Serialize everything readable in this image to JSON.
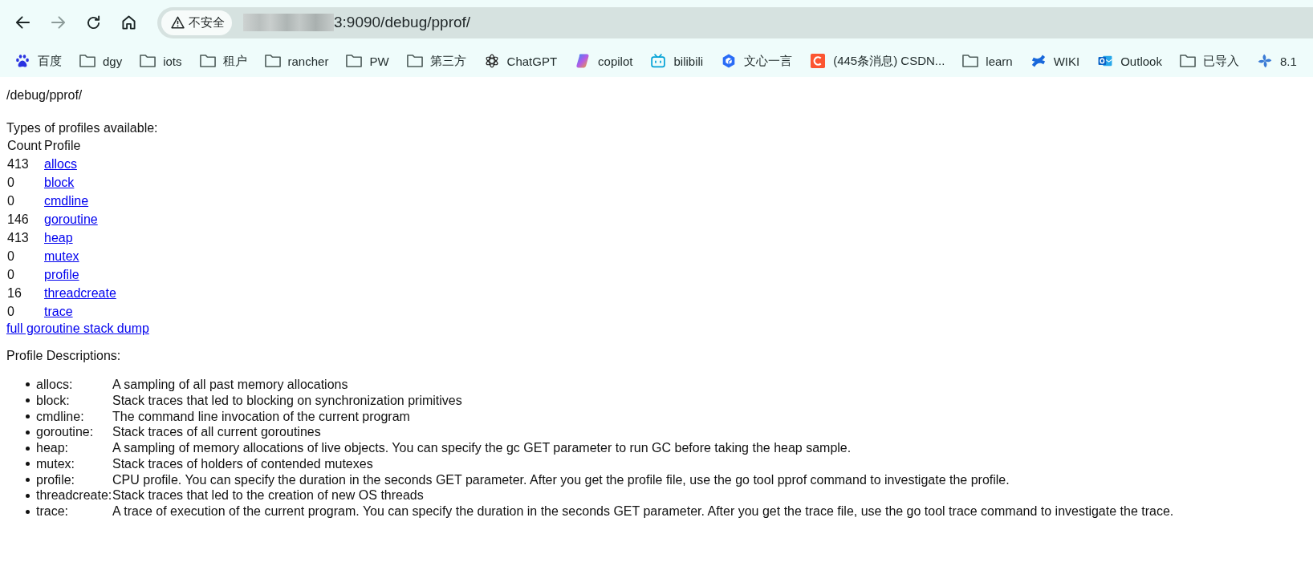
{
  "toolbar": {
    "nav_buttons": [
      {
        "kind": "back",
        "disabled": false
      },
      {
        "kind": "forward",
        "disabled": true
      },
      {
        "kind": "reload",
        "disabled": false
      },
      {
        "kind": "home",
        "disabled": false
      }
    ],
    "address_bar": {
      "security_label": "不安全",
      "url": "3:9090/debug/pprof/"
    }
  },
  "bookmarks_bar": {
    "items": [
      {
        "kind": "paw",
        "label": "百度"
      },
      {
        "kind": "folder",
        "label": "dgy"
      },
      {
        "kind": "folder",
        "label": "iots"
      },
      {
        "kind": "folder",
        "label": "租户"
      },
      {
        "kind": "folder",
        "label": "rancher"
      },
      {
        "kind": "folder",
        "label": "PW"
      },
      {
        "kind": "folder",
        "label": "第三方"
      },
      {
        "kind": "knot",
        "label": "ChatGPT"
      },
      {
        "kind": "swirl",
        "label": "copilot"
      },
      {
        "kind": "tv",
        "label": "bilibili"
      },
      {
        "kind": "hexagon",
        "label": "文心一言"
      },
      {
        "kind": "c-tile",
        "label": "(445条消息) CSDN..."
      },
      {
        "kind": "folder",
        "label": "learn"
      },
      {
        "kind": "cross",
        "label": "WIKI"
      },
      {
        "kind": "mail",
        "label": "Outlook"
      },
      {
        "kind": "folder",
        "label": "已导入"
      },
      {
        "kind": "pinwheel",
        "label": "8.1"
      }
    ]
  },
  "page": {
    "heading": "/debug/pprof/",
    "intro": "Types of profiles available:",
    "table": {
      "columns": [
        "Count",
        "Profile"
      ],
      "rows": [
        {
          "count": "413",
          "profile": "allocs"
        },
        {
          "count": "0",
          "profile": "block"
        },
        {
          "count": "0",
          "profile": "cmdline"
        },
        {
          "count": "146",
          "profile": "goroutine"
        },
        {
          "count": "413",
          "profile": "heap"
        },
        {
          "count": "0",
          "profile": "mutex"
        },
        {
          "count": "0",
          "profile": "profile"
        },
        {
          "count": "16",
          "profile": "threadcreate"
        },
        {
          "count": "0",
          "profile": "trace"
        }
      ]
    },
    "dump_link": "full goroutine stack dump",
    "descriptions_title": "Profile Descriptions:",
    "descriptions": [
      {
        "name": "allocs:",
        "text": "A sampling of all past memory allocations"
      },
      {
        "name": "block:",
        "text": "Stack traces that led to blocking on synchronization primitives"
      },
      {
        "name": "cmdline:",
        "text": "The command line invocation of the current program"
      },
      {
        "name": "goroutine:",
        "text": "Stack traces of all current goroutines"
      },
      {
        "name": "heap:",
        "text": "A sampling of memory allocations of live objects. You can specify the gc GET parameter to run GC before taking the heap sample."
      },
      {
        "name": "mutex:",
        "text": "Stack traces of holders of contended mutexes"
      },
      {
        "name": "profile:",
        "text": "CPU profile. You can specify the duration in the seconds GET parameter. After you get the profile file, use the go tool pprof command to investigate the profile."
      },
      {
        "name": "threadcreate:",
        "text": "Stack traces that led to the creation of new OS threads"
      },
      {
        "name": "trace:",
        "text": "A trace of execution of the current program. You can specify the duration in the seconds GET parameter. After you get the trace file, use the go tool trace command to investigate the trace."
      }
    ]
  }
}
